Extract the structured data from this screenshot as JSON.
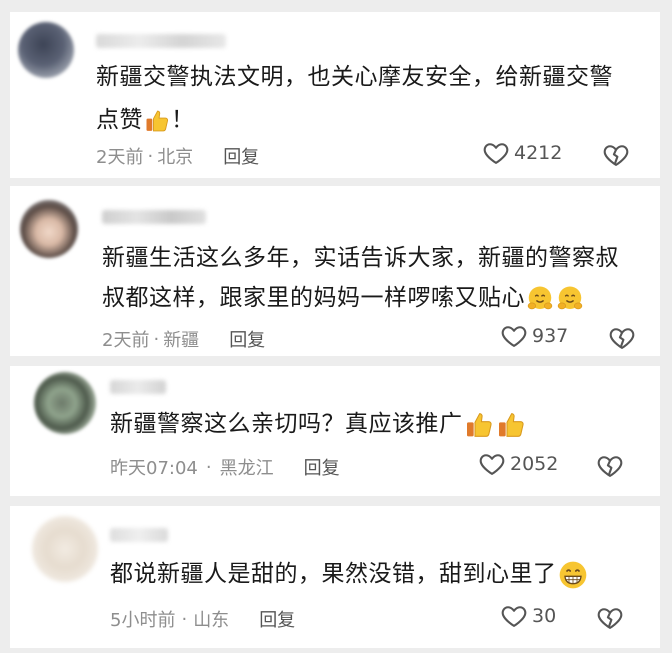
{
  "comments": [
    {
      "text_line1": "新疆交警执法文明，也关心摩友安全，给新疆交警",
      "text_line2": "点赞",
      "text_suffix": "！",
      "time": "2天前",
      "location": "北京",
      "reply_label": "回复",
      "likes": "4212",
      "emoji_icon": "thumbs-up-icon"
    },
    {
      "text_line1": "新疆生活这么多年，实话告诉大家，新疆的警察叔",
      "text_line2": "叔都这样，跟家里的妈妈一样啰嗦又贴心",
      "time": "2天前",
      "location": "新疆",
      "reply_label": "回复",
      "likes": "937",
      "emoji_icon": "hugging-face-icon"
    },
    {
      "text_line1": "新疆警察这么亲切吗？真应该推广",
      "time": "昨天07:04",
      "location": "黑龙江",
      "reply_label": "回复",
      "likes": "2052",
      "emoji_icon": "thumbs-up-icon"
    },
    {
      "text_line1": "都说新疆人是甜的，果然没错，甜到心里了",
      "time": "5小时前",
      "location": "山东",
      "reply_label": "回复",
      "likes": "30",
      "emoji_icon": "grinning-face-icon"
    }
  ],
  "meta_separator": "·",
  "colors": {
    "background": "#ededed",
    "card": "#ffffff",
    "meta_text": "#8e8e8e",
    "emoji_yellow": "#f7c531"
  }
}
